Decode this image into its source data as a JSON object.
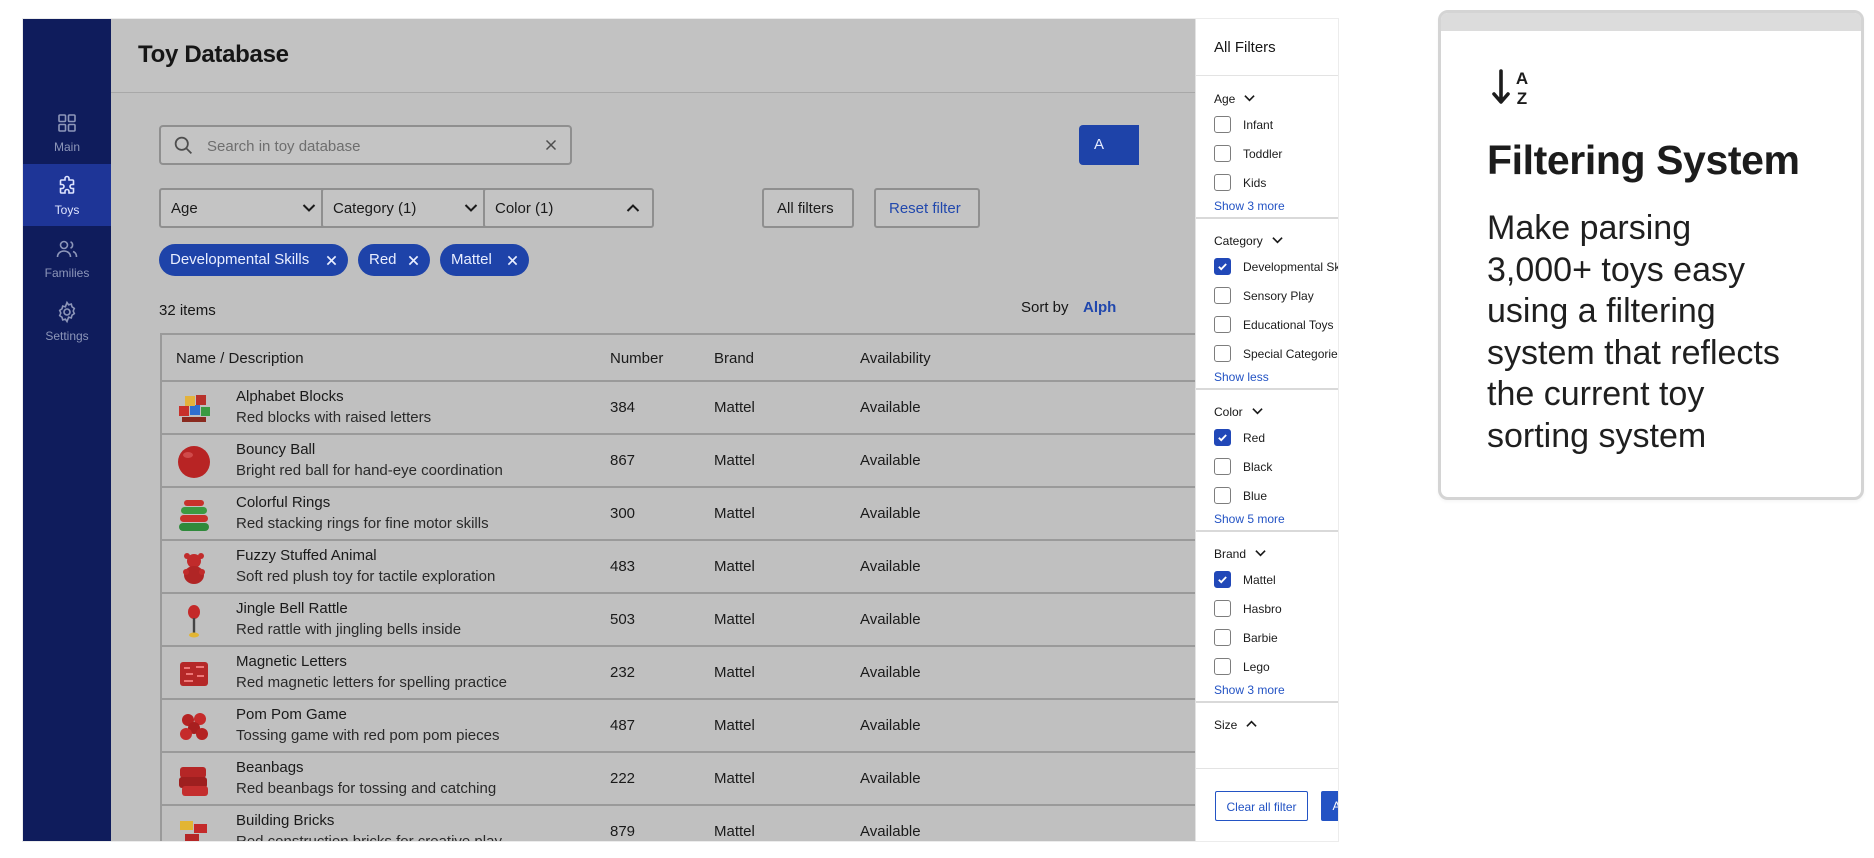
{
  "sidebar": {
    "items": [
      {
        "label": "Main",
        "icon": "grid-icon",
        "active": false
      },
      {
        "label": "Toys",
        "icon": "puzzle-icon",
        "active": true
      },
      {
        "label": "Families",
        "icon": "users-icon",
        "active": false
      },
      {
        "label": "Settings",
        "icon": "gear-icon",
        "active": false
      }
    ]
  },
  "header": {
    "title": "Toy Database"
  },
  "search": {
    "placeholder": "Search in toy database",
    "value": ""
  },
  "toolbar": {
    "add_label": "A"
  },
  "filters": {
    "dropdowns": [
      {
        "label": "Age",
        "open": false
      },
      {
        "label": "Category (1)",
        "open": false
      },
      {
        "label": "Color (1)",
        "open": true
      }
    ],
    "all_filters_label": "All filters",
    "reset_label": "Reset filter",
    "chips": [
      "Developmental Skills",
      "Red",
      "Mattel"
    ]
  },
  "results": {
    "count_label": "32 items",
    "sort_label": "Sort by",
    "sort_value": "Alph"
  },
  "table": {
    "columns": [
      "Name / Description",
      "Number",
      "Brand",
      "Availability"
    ],
    "rows": [
      {
        "name": "Alphabet Blocks",
        "desc": "Red blocks with raised letters",
        "number": "384",
        "brand": "Mattel",
        "availability": "Available",
        "thumb": "blocks"
      },
      {
        "name": "Bouncy Ball",
        "desc": "Bright red ball for hand-eye coordination",
        "number": "867",
        "brand": "Mattel",
        "availability": "Available",
        "thumb": "ball"
      },
      {
        "name": "Colorful Rings",
        "desc": "Red stacking rings for fine motor skills",
        "number": "300",
        "brand": "Mattel",
        "availability": "Available",
        "thumb": "rings"
      },
      {
        "name": "Fuzzy Stuffed Animal",
        "desc": "Soft red plush toy for tactile exploration",
        "number": "483",
        "brand": "Mattel",
        "availability": "Available",
        "thumb": "plush"
      },
      {
        "name": "Jingle Bell Rattle",
        "desc": "Red rattle with jingling bells inside",
        "number": "503",
        "brand": "Mattel",
        "availability": "Available",
        "thumb": "rattle"
      },
      {
        "name": "Magnetic Letters",
        "desc": "Red magnetic letters for spelling practice",
        "number": "232",
        "brand": "Mattel",
        "availability": "Available",
        "thumb": "letters"
      },
      {
        "name": "Pom Pom Game",
        "desc": "Tossing game with red pom pom pieces",
        "number": "487",
        "brand": "Mattel",
        "availability": "Available",
        "thumb": "pompom"
      },
      {
        "name": "Beanbags",
        "desc": "Red beanbags for tossing and catching",
        "number": "222",
        "brand": "Mattel",
        "availability": "Available",
        "thumb": "beanbags"
      },
      {
        "name": "Building Bricks",
        "desc": "Red construction bricks for creative play",
        "number": "879",
        "brand": "Mattel",
        "availability": "Available",
        "thumb": "bricks"
      }
    ]
  },
  "panel": {
    "title": "All Filters",
    "sections": [
      {
        "title": "Age",
        "options": [
          {
            "label": "Infant",
            "checked": false
          },
          {
            "label": "Toddler",
            "checked": false
          },
          {
            "label": "Kids",
            "checked": false
          }
        ],
        "link": "Show 3 more"
      },
      {
        "title": "Category",
        "options": [
          {
            "label": "Developmental Skills",
            "checked": true
          },
          {
            "label": "Sensory Play",
            "checked": false
          },
          {
            "label": "Educational Toys",
            "checked": false
          },
          {
            "label": "Special Categories",
            "checked": false
          }
        ],
        "link": "Show less"
      },
      {
        "title": "Color",
        "options": [
          {
            "label": "Red",
            "checked": true
          },
          {
            "label": "Black",
            "checked": false
          },
          {
            "label": "Blue",
            "checked": false
          }
        ],
        "link": "Show 5 more"
      },
      {
        "title": "Brand",
        "options": [
          {
            "label": "Mattel",
            "checked": true
          },
          {
            "label": "Hasbro",
            "checked": false
          },
          {
            "label": "Barbie",
            "checked": false
          },
          {
            "label": "Lego",
            "checked": false
          }
        ],
        "link": "Show 3 more"
      },
      {
        "title": "Size",
        "options": [],
        "link": ""
      }
    ],
    "clear_label": "Clear all filter",
    "apply_label": "Apply Filter"
  },
  "callout": {
    "icon": "sort-az-icon",
    "title": "Filtering System",
    "body_lines": [
      "Make parsing",
      "3,000+ toys easy",
      "using a filtering",
      "system that reflects",
      "the current toy",
      "sorting system"
    ]
  },
  "colors": {
    "sidebar": "#0f1c5c",
    "accent": "#1e43a9",
    "link": "#2353c4"
  }
}
